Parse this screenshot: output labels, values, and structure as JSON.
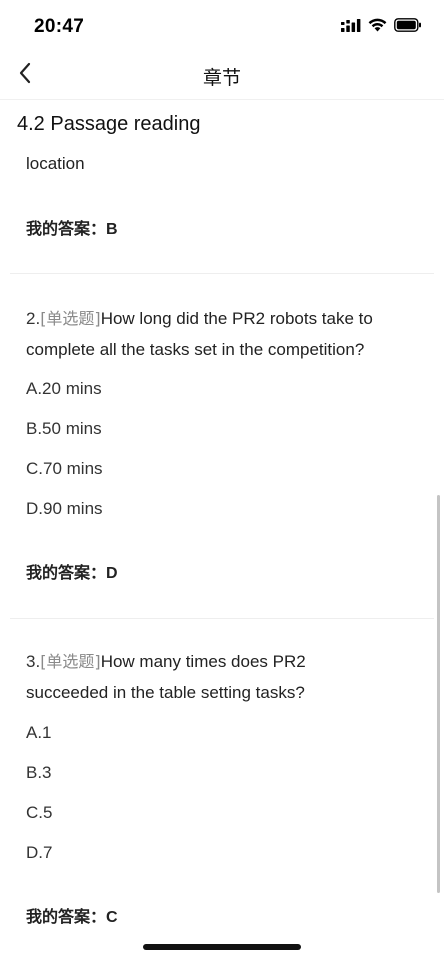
{
  "status": {
    "time": "20:47"
  },
  "nav": {
    "title": "章节"
  },
  "section": {
    "title": "4.2 Passage reading"
  },
  "questions": [
    {
      "text_tail": "location",
      "answer_label": "我的答案：",
      "answer_value": "B"
    },
    {
      "number": "2.",
      "type": "[单选题]",
      "text_line1": "How long did the PR2 robots take to",
      "text_line2": "complete all the tasks set in the competition?",
      "options": [
        "A.20 mins",
        "B.50 mins",
        "C.70 mins",
        "D.90 mins"
      ],
      "answer_label": "我的答案：",
      "answer_value": "D"
    },
    {
      "number": "3.",
      "type": "[单选题]",
      "text_line1": "How many times does PR2",
      "text_line2": "succeeded in the table setting tasks?",
      "options": [
        "A.1",
        "B.3",
        "C.5",
        "D.7"
      ],
      "answer_label": "我的答案：",
      "answer_value": "C"
    }
  ]
}
